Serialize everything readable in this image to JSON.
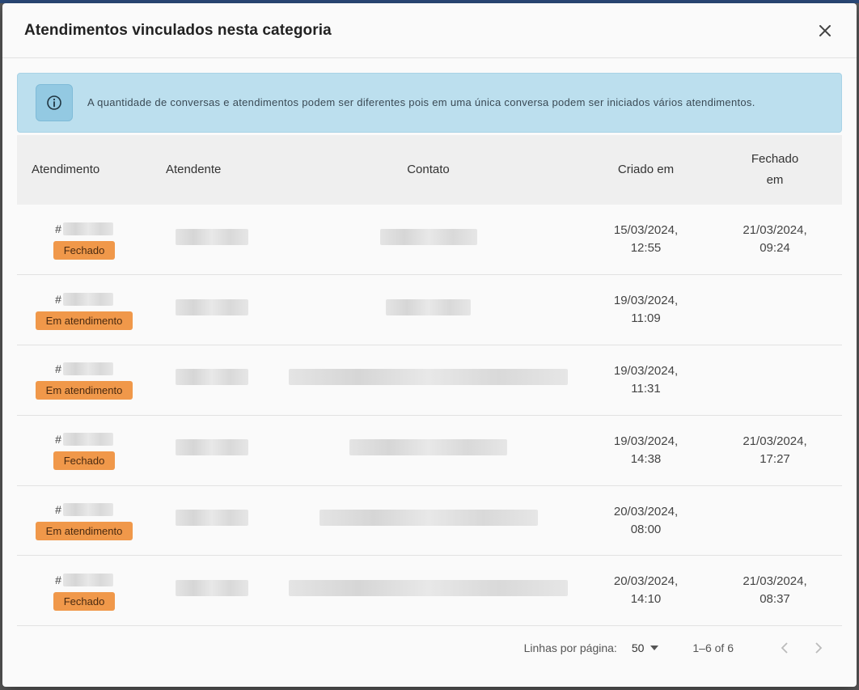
{
  "modal": {
    "title": "Atendimentos vinculados nesta categoria"
  },
  "icons": {
    "close": "close-icon",
    "info": "info-icon",
    "caret": "caret-down-icon",
    "prev": "chevron-left-icon",
    "next": "chevron-right-icon"
  },
  "info_banner": {
    "text": "A quantidade de conversas e atendimentos podem ser diferentes pois em uma única conversa podem ser iniciados vários atendimentos."
  },
  "table": {
    "headers": {
      "atendimento": "Atendimento",
      "atendente": "Atendente",
      "contato": "Contato",
      "criado_em": "Criado em",
      "fechado_em": "Fechado em"
    },
    "rows": [
      {
        "code_prefix": "#",
        "status": "Fechado",
        "created_date": "15/03/2024,",
        "created_time": "12:55",
        "closed_date": "21/03/2024,",
        "closed_time": "09:24"
      },
      {
        "code_prefix": "#",
        "status": "Em atendimento",
        "created_date": "19/03/2024,",
        "created_time": "11:09",
        "closed_date": "",
        "closed_time": ""
      },
      {
        "code_prefix": "#",
        "status": "Em atendimento",
        "created_date": "19/03/2024,",
        "created_time": "11:31",
        "closed_date": "",
        "closed_time": ""
      },
      {
        "code_prefix": "#",
        "status": "Fechado",
        "created_date": "19/03/2024,",
        "created_time": "14:38",
        "closed_date": "21/03/2024,",
        "closed_time": "17:27"
      },
      {
        "code_prefix": "#",
        "status": "Em atendimento",
        "created_date": "20/03/2024,",
        "created_time": "08:00",
        "closed_date": "",
        "closed_time": ""
      },
      {
        "code_prefix": "#",
        "status": "Fechado",
        "created_date": "20/03/2024,",
        "created_time": "14:10",
        "closed_date": "21/03/2024,",
        "closed_time": "08:37"
      }
    ]
  },
  "pagination": {
    "rows_label": "Linhas por página:",
    "rows_value": "50",
    "range": "1–6 of 6"
  },
  "colors": {
    "badge": "#f0984a",
    "banner": "#bcdfee",
    "header_bg": "#efefef"
  }
}
